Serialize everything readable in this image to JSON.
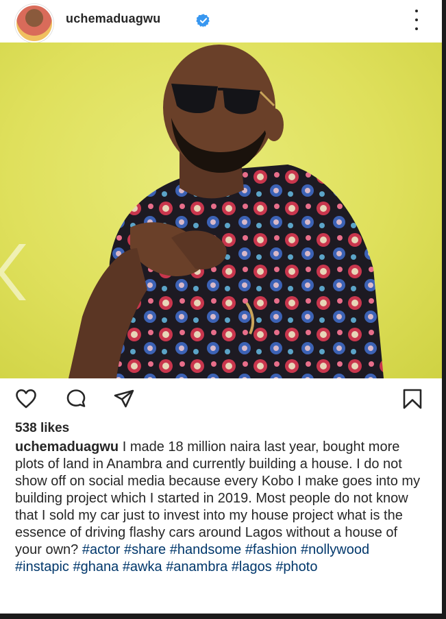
{
  "post": {
    "username": "uchemaduagwu",
    "likes": "538 likes",
    "caption_user": "uchemaduagwu",
    "caption_text": "I made 18 million naira last year, bought more plots of land in Anambra and currently building a house. I do not show off on social media because every Kobo I make goes into my building project which I started in 2019. Most people do not know that I sold my car just to invest into my house project what is the essence of driving flashy cars around Lagos without a house of your own?",
    "hashtags": [
      "#actor",
      "#share",
      "#handsome",
      "#fashion",
      "#nollywood",
      "#instapic",
      "#ghana",
      "#awka",
      "#anambra",
      "#lagos",
      "#photo"
    ]
  },
  "icons": {
    "verified": "verified-badge-icon",
    "more": "more-options-icon",
    "like": "heart-icon",
    "comment": "comment-icon",
    "share": "send-icon",
    "save": "bookmark-icon",
    "prev": "chevron-left-icon"
  },
  "colors": {
    "verified": "#3897f0",
    "hashtag": "#00376b",
    "photo_background": "#dfe05c"
  }
}
